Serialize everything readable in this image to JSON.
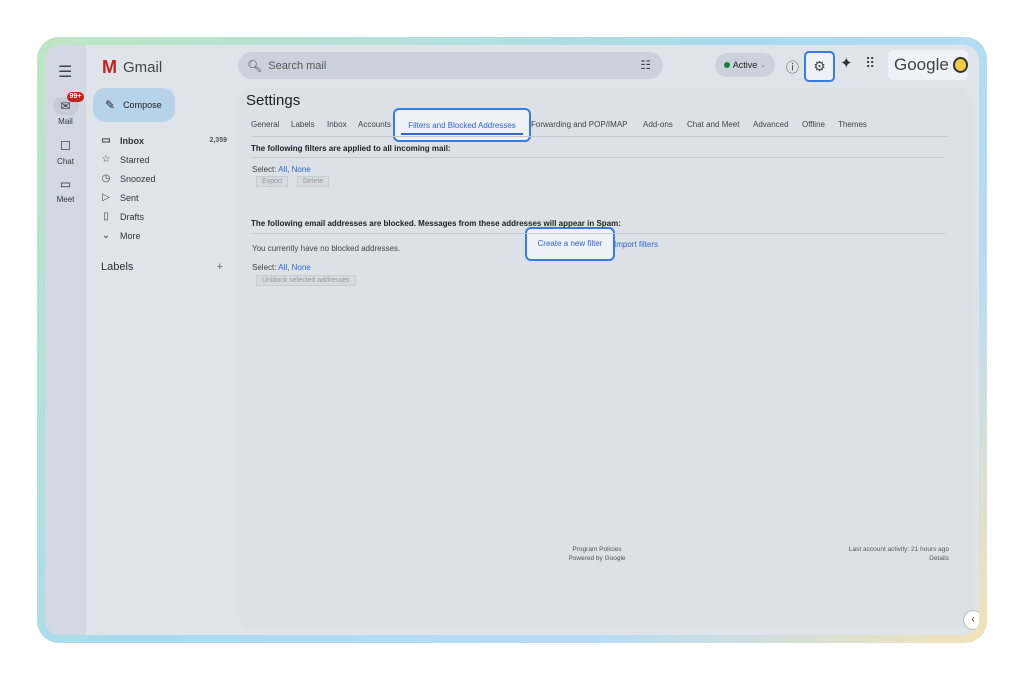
{
  "rail": {
    "items": [
      {
        "label": "Mail",
        "badge": "99+"
      },
      {
        "label": "Chat"
      },
      {
        "label": "Meet"
      }
    ]
  },
  "app": {
    "name": "Gmail"
  },
  "search": {
    "placeholder": "Search mail"
  },
  "status": {
    "label": "Active",
    "color": "#188038"
  },
  "google": {
    "label": "Google"
  },
  "compose": {
    "label": "Compose"
  },
  "nav": [
    {
      "label": "Inbox",
      "count": "2,359"
    },
    {
      "label": "Starred"
    },
    {
      "label": "Snoozed"
    },
    {
      "label": "Sent"
    },
    {
      "label": "Drafts"
    },
    {
      "label": "More"
    }
  ],
  "labels": {
    "title": "Labels"
  },
  "settings": {
    "title": "Settings",
    "tabs": [
      "General",
      "Labels",
      "Inbox",
      "Accounts",
      "Filters and Blocked Addresses",
      "Forwarding and POP/IMAP",
      "Add-ons",
      "Chat and Meet",
      "Advanced",
      "Offline",
      "Themes"
    ],
    "filters_heading": "The following filters are applied to all incoming mail:",
    "select_label": "Select:",
    "select_all": "All",
    "select_none": "None",
    "export_label": "Export",
    "delete_label": "Delete",
    "create_filter": "Create a new filter",
    "import_filters": "Import filters",
    "blocked_heading": "The following email addresses are blocked. Messages from these addresses will appear in Spam:",
    "no_blocked": "You currently have no blocked addresses.",
    "unblock_label": "Unblock selected addresses"
  },
  "footer": {
    "policies": "Program Policies",
    "powered": "Powered by Google",
    "activity": "Last account activity: 21 hours ago",
    "details": "Details"
  },
  "accent": "#3a7be0"
}
